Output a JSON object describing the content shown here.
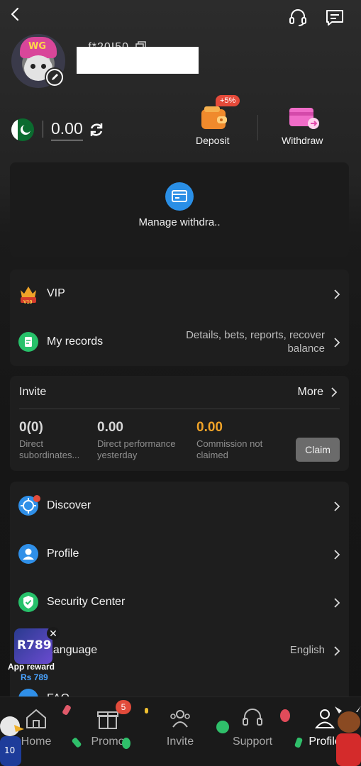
{
  "header": {
    "back_icon": "back-chevron-icon",
    "support_icon": "headset-icon",
    "message_icon": "message-icon"
  },
  "user": {
    "username": "...f*20I50",
    "avatar_hat_text": "WG"
  },
  "wallet": {
    "balance": "0.00",
    "currency_flag": "pakistan-flag-icon",
    "deposit_label": "Deposit",
    "deposit_bonus": "+5%",
    "withdraw_label": "Withdraw"
  },
  "manage": {
    "label": "Manage withdra.."
  },
  "vip_card": {
    "vip_label": "VIP",
    "vip_level": "V10",
    "records_label": "My records",
    "records_hint": "Details, bets, reports, recover balance",
    "records_hint_line1": "Details, bets, reports, recover",
    "records_hint_line2": "balance"
  },
  "invite": {
    "title": "Invite",
    "more_label": "More",
    "stats": [
      {
        "value": "0(0)",
        "label_line1": "Direct",
        "label_line2": "subordinates..."
      },
      {
        "value": "0.00",
        "label_line1": "Direct performance",
        "label_line2": "yesterday"
      },
      {
        "value": "0.00",
        "label_line1": "Commission not",
        "label_line2": "claimed"
      }
    ],
    "claim_label": "Claim"
  },
  "menu": [
    {
      "label": "Discover",
      "value": ""
    },
    {
      "label": "Profile",
      "value": ""
    },
    {
      "label": "Security Center",
      "value": ""
    },
    {
      "label": "Language",
      "value": "English"
    },
    {
      "label": "FAQ",
      "value": ""
    }
  ],
  "floating_reward": {
    "logo": "R789",
    "title": "App reward",
    "amount": "Rs 789"
  },
  "bottom_nav": {
    "items": [
      {
        "label": "Home"
      },
      {
        "label": "Promo",
        "badge": "5"
      },
      {
        "label": "Invite"
      },
      {
        "label": "Support"
      },
      {
        "label": "Profile"
      }
    ],
    "active": "Profile"
  },
  "colors": {
    "accent_gold": "#f0a328",
    "claim_button": "#6b6b6b",
    "badge_red": "#e14b3b",
    "manage_blue": "#2a8fe6"
  }
}
